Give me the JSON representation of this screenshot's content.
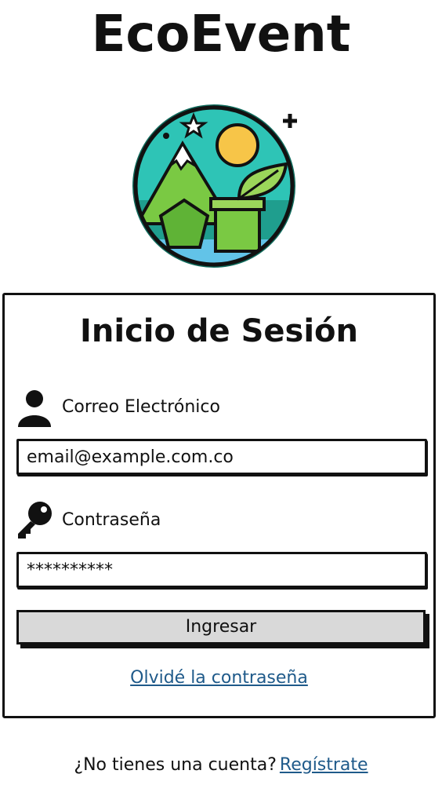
{
  "header": {
    "app_name": "EcoEvent"
  },
  "logo": {
    "icon": "eco-landscape-logo",
    "colors": {
      "ring": "#0f6b5c",
      "sky": "#2ec4b6",
      "sun": "#f7c548",
      "mountain": "#7ac943",
      "water": "#62c3e8"
    }
  },
  "login": {
    "title": "Inicio de Sesión",
    "email": {
      "icon": "user-icon",
      "label": "Correo Electrónico",
      "value": "email@example.com.co"
    },
    "password": {
      "icon": "key-icon",
      "label": "Contraseña",
      "value": "**********"
    },
    "submit_label": "Ingresar",
    "forgot_label": "Olvidé la contraseña"
  },
  "footer": {
    "prompt": "¿No tienes una cuenta?",
    "register_label": "Regístrate"
  },
  "colors": {
    "link": "#1f5a8a",
    "button_bg": "#d9d9d9",
    "border": "#111111"
  }
}
